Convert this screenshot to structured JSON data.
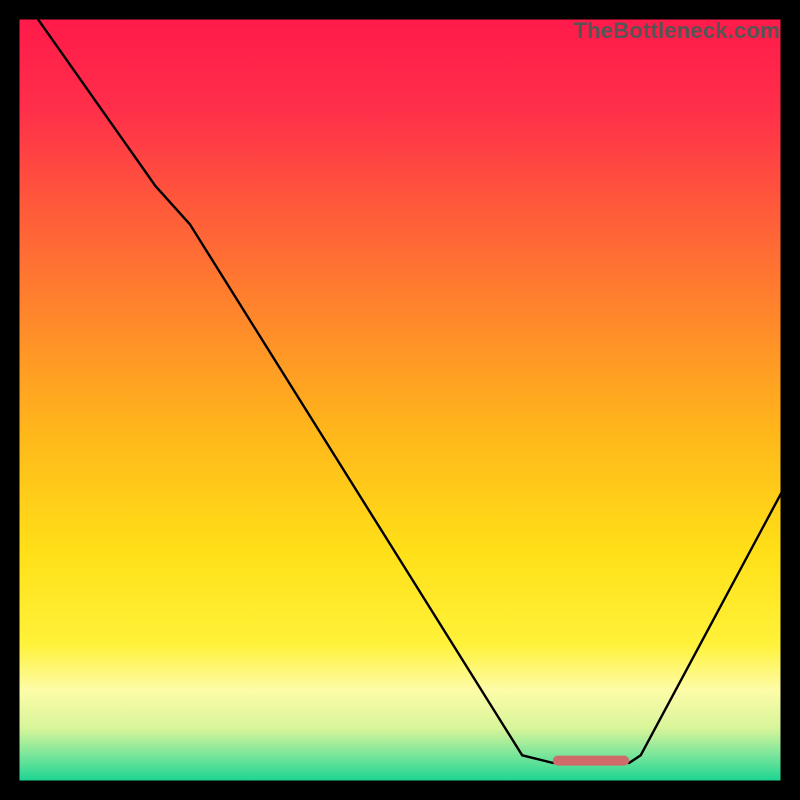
{
  "watermark": "TheBottleneck.com",
  "chart_data": {
    "type": "line",
    "title": "",
    "xlabel": "",
    "ylabel": "",
    "xlim": [
      0,
      100
    ],
    "ylim": [
      0,
      100
    ],
    "grid": false,
    "series": [
      {
        "name": "curve",
        "x": [
          2.5,
          18,
          22.5,
          66,
          70,
          80,
          81.5,
          100
        ],
        "values": [
          100,
          78,
          73,
          3.5,
          2.5,
          2.5,
          3.5,
          38
        ]
      }
    ],
    "marker": {
      "x_start": 70,
      "x_end": 80,
      "y": 2.8,
      "color": "#cf6b6b"
    },
    "background_gradient": {
      "stops": [
        {
          "offset": 0.0,
          "color": "#ff1a4a"
        },
        {
          "offset": 0.12,
          "color": "#ff2f4a"
        },
        {
          "offset": 0.25,
          "color": "#ff5a3a"
        },
        {
          "offset": 0.4,
          "color": "#ff8a2a"
        },
        {
          "offset": 0.55,
          "color": "#ffb91a"
        },
        {
          "offset": 0.7,
          "color": "#ffe018"
        },
        {
          "offset": 0.82,
          "color": "#fff23a"
        },
        {
          "offset": 0.88,
          "color": "#fdfca8"
        },
        {
          "offset": 0.93,
          "color": "#d7f59a"
        },
        {
          "offset": 0.97,
          "color": "#6be39a"
        },
        {
          "offset": 1.0,
          "color": "#18d492"
        }
      ]
    },
    "line_color": "#000000",
    "line_width": 2.4
  }
}
